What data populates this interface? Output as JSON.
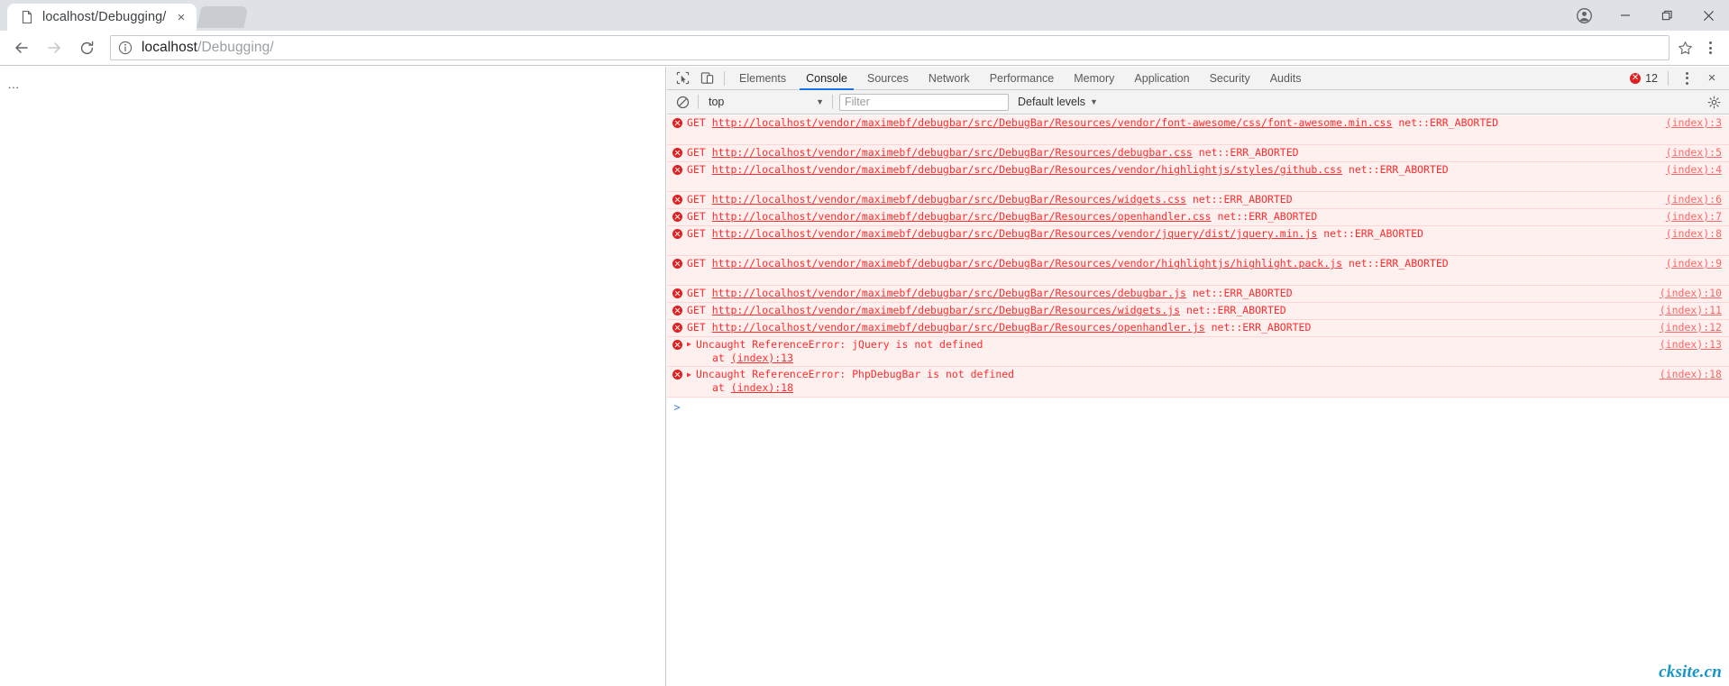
{
  "browser": {
    "tab": {
      "title": "localhost/Debugging/",
      "favicon": "page-icon",
      "close": "×"
    },
    "newtab_label": "",
    "window_buttons": [
      {
        "name": "profile-avatar-button",
        "glyph": "account"
      },
      {
        "name": "minimize-button",
        "glyph": "minimize"
      },
      {
        "name": "maximize-button",
        "glyph": "maximize"
      },
      {
        "name": "close-window-button",
        "glyph": "close"
      }
    ],
    "nav": {
      "back": "back-arrow",
      "forward": "forward-arrow",
      "reload": "reload-arrow"
    },
    "omnibox": {
      "info_icon": "info-circle-icon",
      "url_host": "localhost",
      "url_path": "/Debugging/",
      "full_url": "localhost/Debugging/",
      "star_icon": "bookmark-star-icon"
    },
    "menu_label": "chrome-menu"
  },
  "page": {
    "placeholder_text": "..."
  },
  "devtools": {
    "toolbar": {
      "inspect_icon": "inspect-element-icon",
      "device_icon": "toggle-device-toolbar-icon",
      "tabs": [
        {
          "label": "Elements",
          "active": false
        },
        {
          "label": "Console",
          "active": true
        },
        {
          "label": "Sources",
          "active": false
        },
        {
          "label": "Network",
          "active": false
        },
        {
          "label": "Performance",
          "active": false
        },
        {
          "label": "Memory",
          "active": false
        },
        {
          "label": "Application",
          "active": false
        },
        {
          "label": "Security",
          "active": false
        },
        {
          "label": "Audits",
          "active": false
        }
      ],
      "error_count": "12",
      "more_label": "more-tools",
      "close_label": "×"
    },
    "filterbar": {
      "clear_icon": "clear-console-icon",
      "context": "top",
      "context_caret": "▼",
      "filter_placeholder": "Filter",
      "filter_value": "",
      "levels_label": "Default levels",
      "levels_caret": "▼",
      "settings_icon": "gear-icon"
    },
    "messages": [
      {
        "type": "error",
        "method": "GET",
        "url": "http://localhost/vendor/maximebf/debugbar/src/DebugBar/Resources/vendor/font-awesome/css/font-awesome.min.css",
        "status": "net::ERR_ABORTED",
        "source": "(index):3",
        "wrapped": true
      },
      {
        "type": "error",
        "method": "GET",
        "url": "http://localhost/vendor/maximebf/debugbar/src/DebugBar/Resources/debugbar.css",
        "status": "net::ERR_ABORTED",
        "source": "(index):5",
        "wrapped": false
      },
      {
        "type": "error",
        "method": "GET",
        "url": "http://localhost/vendor/maximebf/debugbar/src/DebugBar/Resources/vendor/highlightjs/styles/github.css",
        "status": "net::ERR_ABORTED",
        "source": "(index):4",
        "wrapped": true
      },
      {
        "type": "error",
        "method": "GET",
        "url": "http://localhost/vendor/maximebf/debugbar/src/DebugBar/Resources/widgets.css",
        "status": "net::ERR_ABORTED",
        "source": "(index):6",
        "wrapped": false
      },
      {
        "type": "error",
        "method": "GET",
        "url": "http://localhost/vendor/maximebf/debugbar/src/DebugBar/Resources/openhandler.css",
        "status": "net::ERR_ABORTED",
        "source": "(index):7",
        "wrapped": false
      },
      {
        "type": "error",
        "method": "GET",
        "url": "http://localhost/vendor/maximebf/debugbar/src/DebugBar/Resources/vendor/jquery/dist/jquery.min.js",
        "status": "net::ERR_ABORTED",
        "source": "(index):8",
        "wrapped": true
      },
      {
        "type": "error",
        "method": "GET",
        "url": "http://localhost/vendor/maximebf/debugbar/src/DebugBar/Resources/vendor/highlightjs/highlight.pack.js",
        "status": "net::ERR_ABORTED",
        "source": "(index):9",
        "wrapped": true
      },
      {
        "type": "error",
        "method": "GET",
        "url": "http://localhost/vendor/maximebf/debugbar/src/DebugBar/Resources/debugbar.js",
        "status": "net::ERR_ABORTED",
        "source": "(index):10",
        "wrapped": false
      },
      {
        "type": "error",
        "method": "GET",
        "url": "http://localhost/vendor/maximebf/debugbar/src/DebugBar/Resources/widgets.js",
        "status": "net::ERR_ABORTED",
        "source": "(index):11",
        "wrapped": false
      },
      {
        "type": "error",
        "method": "GET",
        "url": "http://localhost/vendor/maximebf/debugbar/src/DebugBar/Resources/openhandler.js",
        "status": "net::ERR_ABORTED",
        "source": "(index):12",
        "wrapped": false
      },
      {
        "type": "exception",
        "expander": "▶",
        "text": "Uncaught ReferenceError: jQuery is not defined",
        "stack_prefix": "at",
        "stack_link": "(index):13",
        "source": "(index):13"
      },
      {
        "type": "exception",
        "expander": "▶",
        "text": "Uncaught ReferenceError: PhpDebugBar is not defined",
        "stack_prefix": "at",
        "stack_link": "(index):18",
        "source": "(index):18"
      }
    ],
    "prompt": {
      "caret": ">",
      "value": ""
    }
  },
  "watermark": {
    "text": "cksite.cn",
    "color": "#1596c8"
  }
}
